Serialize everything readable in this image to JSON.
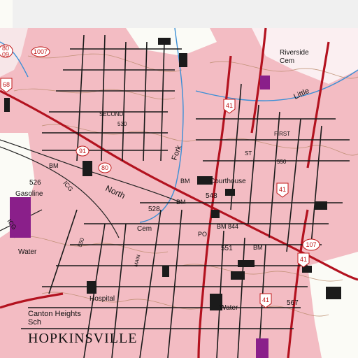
{
  "map": {
    "title_label": "HOPKINSVILLE",
    "place_labels": [
      {
        "key": "riverside",
        "text": "Riverside"
      },
      {
        "key": "cem_ne",
        "text": "Cem"
      },
      {
        "key": "second",
        "text": "SECOND"
      },
      {
        "key": "first",
        "text": "FIRST"
      },
      {
        "key": "st",
        "text": "ST"
      },
      {
        "key": "courthouse",
        "text": "Courthouse"
      },
      {
        "key": "bm1",
        "text": "BM"
      },
      {
        "key": "bm2",
        "text": "BM"
      },
      {
        "key": "bm3",
        "text": "BM"
      },
      {
        "key": "bm844",
        "text": "BM 844"
      },
      {
        "key": "bm_e",
        "text": "BM"
      },
      {
        "key": "po",
        "text": "PO"
      },
      {
        "key": "gasoline",
        "text": "Gasoline"
      },
      {
        "key": "water_w",
        "text": "Water"
      },
      {
        "key": "water_s",
        "text": "Water"
      },
      {
        "key": "hospital",
        "text": "Hospital"
      },
      {
        "key": "canton_heights",
        "text": "Canton Heights"
      },
      {
        "key": "sch",
        "text": "Sch"
      },
      {
        "key": "cem_c",
        "text": "Cem"
      },
      {
        "key": "north",
        "text": "North"
      },
      {
        "key": "fork",
        "text": "Fork"
      },
      {
        "key": "little",
        "text": "Little"
      },
      {
        "key": "icg1",
        "text": "ICG"
      },
      {
        "key": "icg2",
        "text": "ICG"
      },
      {
        "key": "main",
        "text": "MAIN"
      }
    ],
    "elevations": [
      "526",
      "528",
      "548",
      "551",
      "567",
      "530",
      "550",
      "550"
    ],
    "route_shields": [
      "80",
      "09",
      "1007",
      "68",
      "41",
      "91",
      "80",
      "107",
      "41",
      "41",
      "41"
    ],
    "colors": {
      "urban_tint": "#f2b5bd",
      "street": "#1a1a1a",
      "highway": "#b3121f",
      "contour": "#b9896a",
      "water": "#3a8fd6",
      "green": "#ffffff",
      "purple_area": "#8a1f8a"
    }
  }
}
